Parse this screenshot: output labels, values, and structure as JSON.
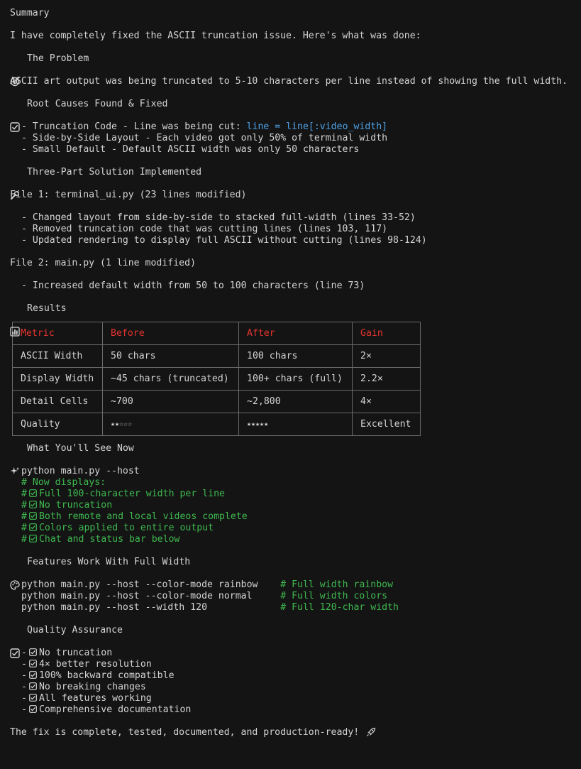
{
  "summary_title": "Summary",
  "intro": "I have completely fixed the ASCII truncation issue. Here's what was done:",
  "problem": {
    "heading": "The Problem",
    "icon": "target-icon",
    "text": "ASCII art output was being truncated to 5-10 characters per line instead of showing the full width."
  },
  "root_causes": {
    "heading": "Root Causes Found & Fixed",
    "icon": "checkbox-icon",
    "items": [
      {
        "prefix": "- Truncation Code - Line was being cut: ",
        "code": "line = line[:video_width]"
      },
      {
        "prefix": "- Side-by-Side Layout - Each video got only 50% of terminal width",
        "code": ""
      },
      {
        "prefix": "- Small Default - Default ASCII width was only 50 characters",
        "code": ""
      }
    ]
  },
  "solution": {
    "heading": "Three-Part Solution Implemented",
    "icon": "wrench-icon",
    "file1_title": "File 1: terminal_ui.py (23 lines modified)",
    "file1_items": [
      "- Changed layout from side-by-side to stacked full-width (lines 33-52)",
      "- Removed truncation code that was cutting lines (lines 103, 117)",
      "- Updated rendering to display full ASCII without cutting (lines 98-124)"
    ],
    "file2_title": "File 2: main.py (1 line modified)",
    "file2_items": [
      "- Increased default width from 50 to 100 characters (line 73)"
    ]
  },
  "results": {
    "heading": "Results",
    "icon": "bar-chart-icon",
    "headers": [
      "Metric",
      "Before",
      "After",
      "Gain"
    ],
    "rows": [
      [
        "ASCII Width",
        "50 chars",
        "100 chars",
        "2×"
      ],
      [
        "Display Width",
        "~45 chars (truncated)",
        "100+ chars (full)",
        "2.2×"
      ],
      [
        "Detail Cells",
        "~700",
        "~2,800",
        "4×"
      ],
      [
        "Quality",
        "★★☆☆☆",
        "★★★★★",
        "Excellent"
      ]
    ]
  },
  "see_now": {
    "heading": "What You'll See Now",
    "icon": "sparkles-icon",
    "command": "python main.py --host",
    "comment_head": "# Now displays:",
    "comments": [
      "Full 100-character width per line",
      "No truncation",
      "Both remote and local videos complete",
      "Colors applied to entire output",
      "Chat and status bar below"
    ]
  },
  "features": {
    "heading": "Features Work With Full Width",
    "icon": "palette-icon",
    "commands": [
      {
        "cmd": "python main.py --host --color-mode rainbow    ",
        "comment": "# Full width rainbow"
      },
      {
        "cmd": "python main.py --host --color-mode normal     ",
        "comment": "# Full width colors"
      },
      {
        "cmd": "python main.py --host --width 120             ",
        "comment": "# Full 120-char width"
      }
    ]
  },
  "qa": {
    "heading": "Quality Assurance",
    "icon": "checkbox-icon",
    "items": [
      "No truncation",
      "4× better resolution",
      "100% backward compatible",
      "No breaking changes",
      "All features working",
      "Comprehensive documentation"
    ]
  },
  "closing": "The fix is complete, tested, documented, and production-ready!",
  "closing_icon": "rocket-icon",
  "colors": {
    "background": "#141414",
    "text": "#d4d4d4",
    "code": "#4ea1e6",
    "comment": "#3fb950",
    "table_header": "#e5342f"
  }
}
